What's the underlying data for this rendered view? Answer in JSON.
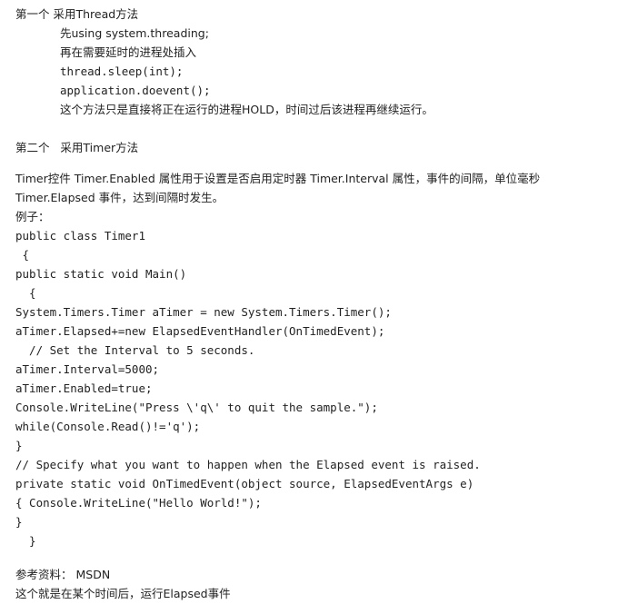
{
  "method1": {
    "heading": "第一个 采用Thread方法",
    "lines": [
      "先using system.threading;",
      "再在需要延时的进程处插入",
      "thread.sleep(int);",
      "application.doevent();",
      "这个方法只是直接将正在运行的进程HOLD，时间过后该进程再继续运行。"
    ]
  },
  "method2": {
    "heading": "第二个   采用Timer方法",
    "desc_line1": "Timer控件 Timer.Enabled 属性用于设置是否启用定时器 Timer.Interval 属性，事件的间隔，单位毫秒",
    "desc_line2": "Timer.Elapsed 事件，达到间隔时发生。",
    "example_label": "例子：",
    "code": [
      "public class Timer1",
      " {",
      "public static void Main()",
      "  {",
      "System.Timers.Timer aTimer = new System.Timers.Timer();",
      "aTimer.Elapsed+=new ElapsedEventHandler(OnTimedEvent);",
      "  // Set the Interval to 5 seconds.",
      "aTimer.Interval=5000;",
      "aTimer.Enabled=true;",
      "Console.WriteLine(\"Press \\'q\\' to quit the sample.\");",
      "while(Console.Read()!='q');",
      "}",
      "// Specify what you want to happen when the Elapsed event is raised.",
      "private static void OnTimedEvent(object source, ElapsedEventArgs e)",
      "{ Console.WriteLine(\"Hello World!\");",
      "}",
      "  }"
    ]
  },
  "reference": {
    "label": "参考资料： MSDN",
    "summary": "这个就是在某个时间后，运行Elapsed事件"
  }
}
